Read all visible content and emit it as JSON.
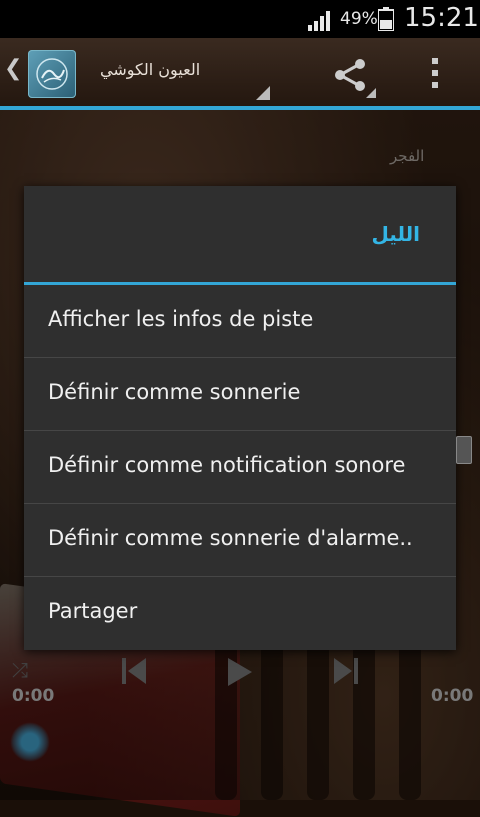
{
  "status_bar": {
    "battery_pct": "49%",
    "time": "15:21"
  },
  "action_bar": {
    "title": "العيون الكوشي"
  },
  "background": {
    "label": "الفجر"
  },
  "player": {
    "elapsed": "0:00",
    "duration": "0:00"
  },
  "dialog": {
    "title": "الليل",
    "items": [
      {
        "label": "Afficher les infos de piste"
      },
      {
        "label": "Définir comme sonnerie"
      },
      {
        "label": "Définir comme notification sonore"
      },
      {
        "label": "Définir comme sonnerie d'alarme.."
      },
      {
        "label": "Partager"
      }
    ]
  },
  "colors": {
    "accent": "#33a6d6",
    "dialog_bg": "#2f2f2f",
    "status_bar": "#000000"
  },
  "icons": [
    "signal-icon",
    "battery-icon",
    "back-chevron-icon",
    "app-logo-icon",
    "share-icon",
    "overflow-menu-icon",
    "shuffle-icon",
    "previous-icon",
    "play-icon",
    "next-icon"
  ]
}
